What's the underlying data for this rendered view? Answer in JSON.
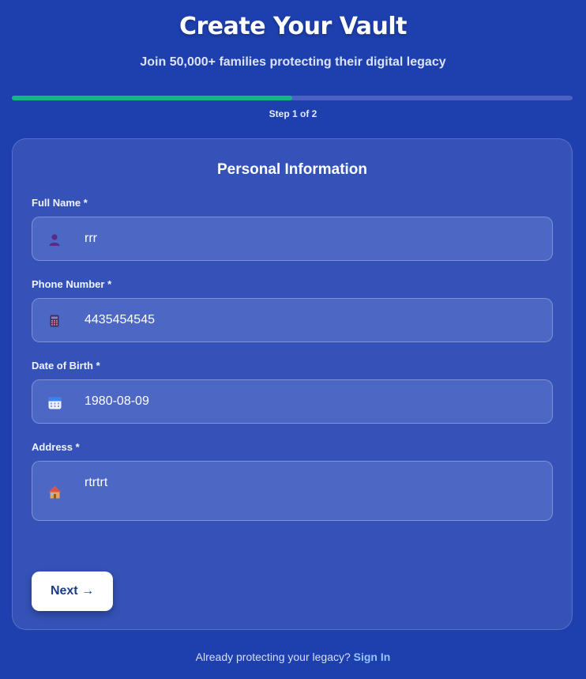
{
  "header": {
    "title": "Create Your Vault",
    "subtitle": "Join 50,000+ families protecting their digital legacy"
  },
  "progress": {
    "fraction": 0.5,
    "step_label": "Step 1 of 2",
    "fill_color": "#10b981"
  },
  "form": {
    "section_title": "Personal Information",
    "fields": [
      {
        "label": "Full Name *",
        "value": "rrr",
        "icon": "person-icon"
      },
      {
        "label": "Phone Number *",
        "value": "4435454545",
        "icon": "phone-icon"
      },
      {
        "label": "Date of Birth *",
        "value": "1980-08-09",
        "icon": "calendar-icon"
      },
      {
        "label": "Address *",
        "value": "rtrtrt",
        "icon": "house-icon"
      }
    ],
    "next_label": "Next →"
  },
  "footer": {
    "prompt": "Already protecting your legacy?",
    "signin_label": "Sign In"
  },
  "colors": {
    "background": "#1e40af",
    "card": "#3552b8",
    "input": "#4d68c4",
    "button_text": "#1e3a8a",
    "link": "#93c5fd"
  }
}
